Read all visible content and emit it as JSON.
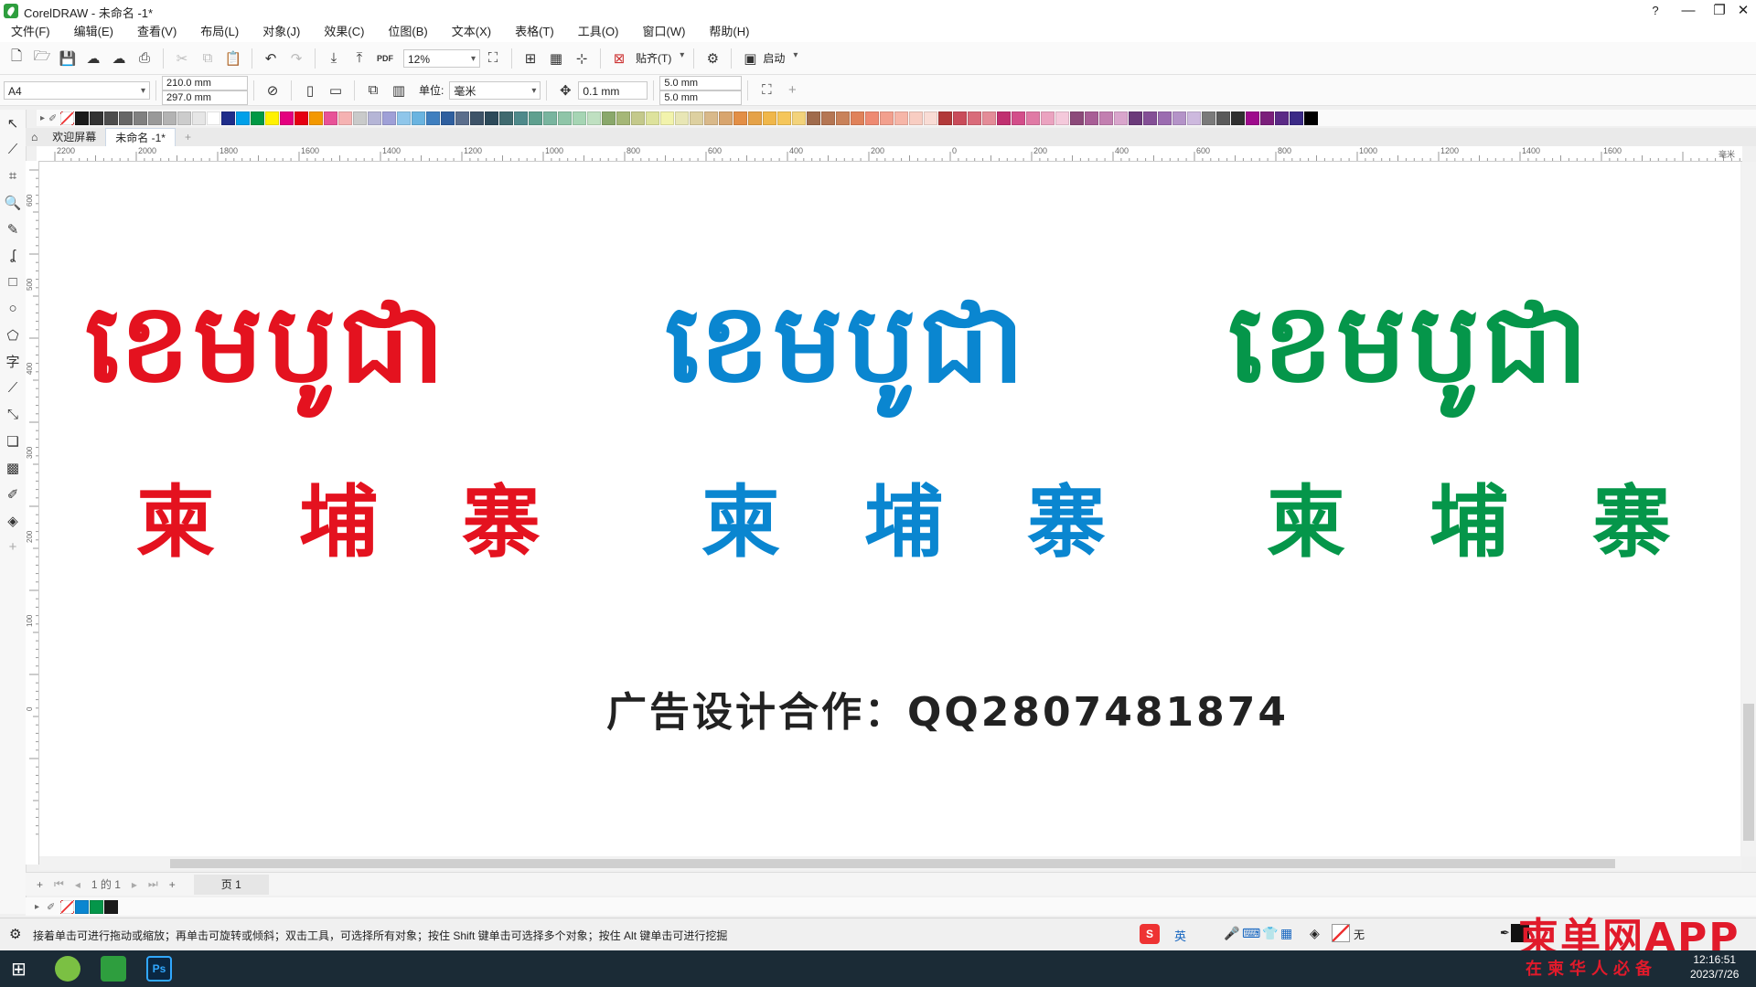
{
  "window": {
    "title": "CorelDRAW - 未命名 -1*",
    "minimize": "—",
    "restore": "❐",
    "close": "✕",
    "help_glyph": "?"
  },
  "menu": [
    "文件(F)",
    "编辑(E)",
    "查看(V)",
    "布局(L)",
    "对象(J)",
    "效果(C)",
    "位图(B)",
    "文本(X)",
    "表格(T)",
    "工具(O)",
    "窗口(W)",
    "帮助(H)"
  ],
  "std_toolbar": {
    "zoom": "12%",
    "snap_label": "贴齐(T)",
    "launch_label": "启动",
    "pdf_label": "PDF"
  },
  "prop_toolbar": {
    "page_size": "A4",
    "width": "210.0 mm",
    "height": "297.0 mm",
    "unit_label": "单位:",
    "unit_value": "毫米",
    "nudge": "0.1 mm",
    "dup_x": "5.0 mm",
    "dup_y": "5.0 mm"
  },
  "palette_colors": [
    "#1a1a1a",
    "#333333",
    "#4d4d4d",
    "#666666",
    "#808080",
    "#999999",
    "#b3b3b3",
    "#cccccc",
    "#e6e6e6",
    "#ffffff",
    "#1f2d8a",
    "#00a0e9",
    "#009944",
    "#fff100",
    "#e4007f",
    "#e60012",
    "#f39800",
    "#e85298",
    "#f5b2b2",
    "#c9caca",
    "#b5b5d6",
    "#9fa0d7",
    "#8fc6ea",
    "#6ab4e0",
    "#3f7fbf",
    "#2f5f9f",
    "#5b6e8c",
    "#3e5368",
    "#2d4a5a",
    "#406a6f",
    "#4f8a8b",
    "#5fa08f",
    "#79b59f",
    "#8fc5a8",
    "#a6d5b4",
    "#bfe0c1",
    "#8aa86b",
    "#a5b777",
    "#c4c98b",
    "#dde29c",
    "#f2f3ac",
    "#e8e6b5",
    "#ddd0a0",
    "#d9b98a",
    "#d8a56e",
    "#e38f46",
    "#e5a248",
    "#f0b74a",
    "#f5c65a",
    "#f3d37b",
    "#a06b4c",
    "#b57653",
    "#c9825a",
    "#e0825a",
    "#ee8a72",
    "#f2a08e",
    "#f6b6a8",
    "#f8cdc2",
    "#f9dcd5",
    "#b23a3a",
    "#c94c5a",
    "#d96b7a",
    "#e48c98",
    "#c03070",
    "#d34e8a",
    "#e07aa5",
    "#eba3c0",
    "#f4c9db",
    "#8c4a7a",
    "#a85e96",
    "#c27fb0",
    "#d9a5cc",
    "#6b3a7a",
    "#844f96",
    "#9b6cb0",
    "#b493c8",
    "#cdb9de",
    "#7a7a7a",
    "#5a5a5a",
    "#303030",
    "#9e0a8c",
    "#7b1f7b",
    "#5b2a86",
    "#3b2a86",
    "#000000"
  ],
  "tabs": {
    "welcome": "欢迎屏幕",
    "doc": "未命名 -1*",
    "add": "+"
  },
  "ruler_top_labels": [
    "2200",
    "2000",
    "1800",
    "1600",
    "1400",
    "1200",
    "1000",
    "800",
    "600",
    "400",
    "200",
    "0",
    "200",
    "400",
    "600",
    "800",
    "1000",
    "1200",
    "1400",
    "1600"
  ],
  "ruler_top_unit": "毫米",
  "ruler_left_labels": [
    "600",
    "500",
    "400",
    "300",
    "200",
    "100",
    "0"
  ],
  "canvas": {
    "khmer_red": "ខេមបូជា",
    "khmer_blue": "ខេមបូជា",
    "khmer_green": "ខេមបូជា",
    "cn_chars": [
      "柬",
      "埔",
      "寨"
    ],
    "ad_text": "广告设计合作：QQ2807481874",
    "colors": {
      "red": "#e4121f",
      "blue": "#0a86d0",
      "green": "#05964a"
    }
  },
  "pagebar": {
    "page_counter": "1 的 1",
    "page_tab": "页 1"
  },
  "status": {
    "hint": "接着单击可进行拖动或缩放；再单击可旋转或倾斜；双击工具，可选择所有对象；按住 Shift 键单击可选择多个对象；按住 Alt 键单击可进行挖掘",
    "fill_none": "无",
    "ime": "英"
  },
  "watermark": {
    "main": "柬单网APP",
    "sub": "在柬华人必备"
  },
  "clock": {
    "time": "12:16:51",
    "date": "2023/7/26"
  }
}
